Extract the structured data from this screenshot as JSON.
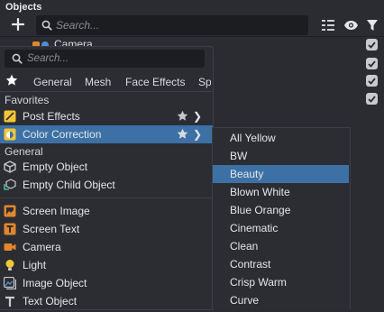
{
  "panel": {
    "title": "Objects",
    "search_placeholder": "Search...",
    "visible_object": "Camera"
  },
  "menu": {
    "search_placeholder": "Search...",
    "tabs": [
      "General",
      "Mesh",
      "Face Effects",
      "Spe"
    ],
    "favorites_header": "Favorites",
    "general_header": "General",
    "favorites": [
      {
        "label": "Post Effects",
        "icon": "post-effects-icon"
      },
      {
        "label": "Color Correction",
        "icon": "color-correction-icon"
      }
    ],
    "general_items": [
      {
        "label": "Empty Object",
        "icon": "empty-object-icon"
      },
      {
        "label": "Empty Child Object",
        "icon": "empty-child-object-icon"
      }
    ],
    "other_items": [
      {
        "label": "Screen Image",
        "icon": "screen-image-icon"
      },
      {
        "label": "Screen Text",
        "icon": "screen-text-icon"
      },
      {
        "label": "Camera",
        "icon": "camera-icon"
      },
      {
        "label": "Light",
        "icon": "light-bulb-icon"
      },
      {
        "label": "Image Object",
        "icon": "image-object-icon"
      },
      {
        "label": "Text Object",
        "icon": "text-object-icon"
      }
    ]
  },
  "submenu": {
    "items": [
      "All Yellow",
      "BW",
      "Beauty",
      "Blown White",
      "Blue Orange",
      "Cinematic",
      "Clean",
      "Contrast",
      "Crisp Warm",
      "Curve"
    ],
    "selected": "Beauty"
  },
  "colors": {
    "accent": "#3d71a6",
    "menu_bg": "#2b2d32",
    "panel_bg": "#2a2c31"
  }
}
